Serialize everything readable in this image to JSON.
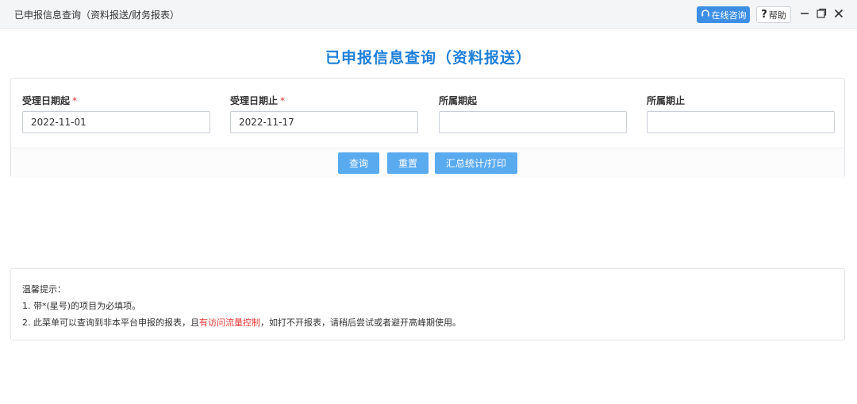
{
  "window": {
    "title": "已申报信息查询（资料报送/财务报表）",
    "online_consult_label": "在线咨询",
    "help_label": "帮助",
    "help_symbol": "?"
  },
  "page": {
    "title": "已申报信息查询（资料报送）"
  },
  "form": {
    "fields": [
      {
        "label": "受理日期起",
        "required": "*",
        "value": "2022-11-01",
        "placeholder": ""
      },
      {
        "label": "受理日期止",
        "required": "*",
        "value": "2022-11-17",
        "placeholder": ""
      },
      {
        "label": "所属期起",
        "required": "",
        "value": "",
        "placeholder": ""
      },
      {
        "label": "所属期止",
        "required": "",
        "value": "",
        "placeholder": ""
      }
    ],
    "buttons": {
      "query": "查询",
      "reset": "重置",
      "summary_print": "汇总统计/打印"
    }
  },
  "tips": {
    "heading": "温馨提示：",
    "line1": "1. 带*(星号)的项目为必填项。",
    "line2_before": "2. 此菜单可以查询到非本平台申报的报表，且",
    "line2_highlight": "有访问流量控制",
    "line2_after": "，如打不开报表，请稍后尝试或者避开高峰期使用。"
  },
  "colors": {
    "accent": "#1e7fd8",
    "button": "#5aaaf0",
    "required": "#e53935"
  },
  "icons": {
    "online": "headset-icon",
    "minimize": "minimize-icon",
    "restore": "restore-icon",
    "close": "close-icon"
  }
}
